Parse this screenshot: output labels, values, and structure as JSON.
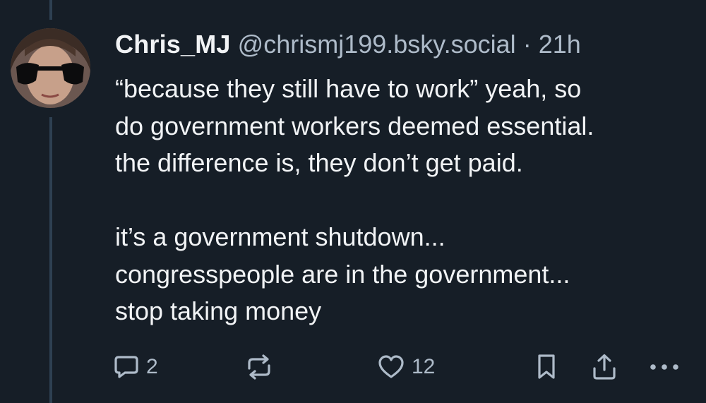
{
  "post": {
    "display_name": "Chris_MJ",
    "handle": "@chrismj199.bsky.social",
    "separator": "·",
    "time_ago": "21h",
    "text_lines": [
      "“because they still have to work” yeah, so",
      "do government workers deemed essential.",
      "the difference is, they don’t get paid.",
      "",
      "it’s a government shutdown...",
      "congresspeople are in the government...",
      "stop taking money"
    ]
  },
  "actions": {
    "reply_icon": "speech-bubble-icon",
    "reply_count": "2",
    "repost_icon": "repost-arrows-icon",
    "like_icon": "heart-outline-icon",
    "like_count": "12",
    "bookmark_icon": "bookmark-icon",
    "share_icon": "share-upload-icon",
    "more_icon": "ellipsis-icon"
  },
  "colors": {
    "background": "#161e27",
    "thread_line": "#2e4052",
    "primary_text": "#f1f3f5",
    "secondary_text": "#aebbc9"
  }
}
